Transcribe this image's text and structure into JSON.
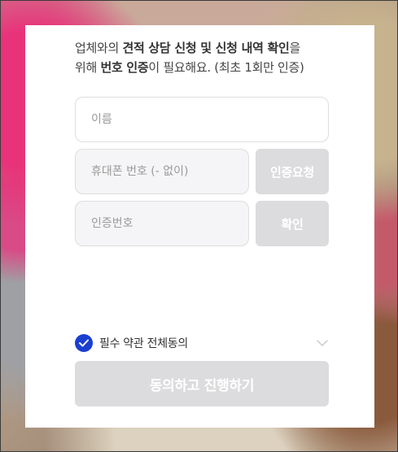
{
  "intro": {
    "line1_prefix": "업체와의 ",
    "line1_bold": "견적 상담 신청 및 신청 내역 확인",
    "line1_suffix": "을",
    "line2_prefix": "위해 ",
    "line2_bold": "번호 인증",
    "line2_suffix": "이 필요해요. (최초 1회만 인증)"
  },
  "form": {
    "name_placeholder": "이름",
    "phone_placeholder": "휴대폰 번호 (- 없이)",
    "code_placeholder": "인증번호",
    "request_button": "인증요청",
    "confirm_button": "확인"
  },
  "agreement": {
    "label": "필수 약관 전체동의",
    "checked": true
  },
  "submit_button": "동의하고 진행하기",
  "colors": {
    "accent": "#1a3fd1",
    "disabled_button": "#dcdcde"
  }
}
